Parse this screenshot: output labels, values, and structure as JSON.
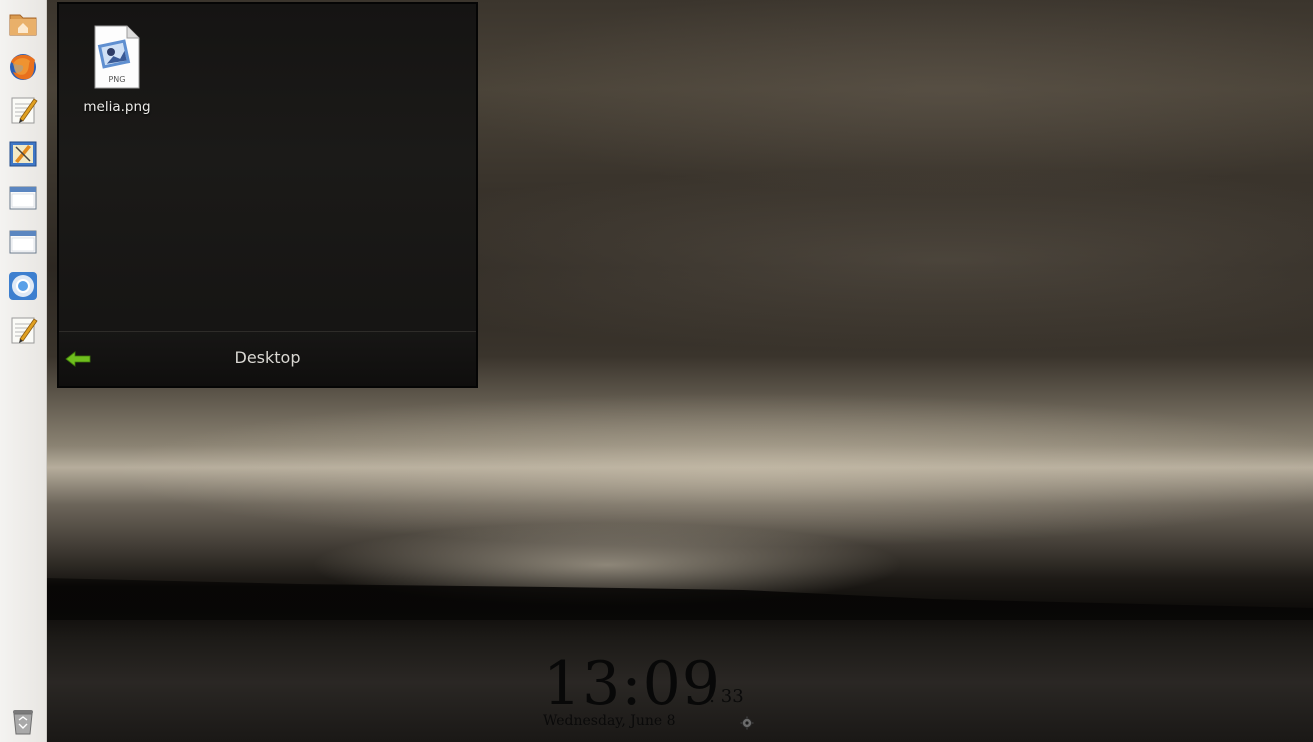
{
  "launcher": {
    "items": [
      {
        "name": "home-folder",
        "icon": "folder-home-icon"
      },
      {
        "name": "firefox",
        "icon": "firefox-icon"
      },
      {
        "name": "text-editor",
        "icon": "text-editor-icon"
      },
      {
        "name": "drawing-app",
        "icon": "drawing-app-icon"
      },
      {
        "name": "window-1",
        "icon": "window-icon"
      },
      {
        "name": "window-2",
        "icon": "window-icon"
      },
      {
        "name": "chromium",
        "icon": "chromium-icon"
      },
      {
        "name": "text-editor-2",
        "icon": "text-editor-icon"
      }
    ],
    "trash": {
      "icon": "trash-icon"
    }
  },
  "panel": {
    "title": "Desktop",
    "files": [
      {
        "label": "melia.png",
        "type": "PNG"
      }
    ]
  },
  "clock": {
    "time": "13:09",
    "seconds": ": 33",
    "date": "Wednesday, June 8"
  },
  "colors": {
    "launcher_bg": "#f4f3f1",
    "panel_bg": "#1b1a18",
    "back_arrow": "#6fbf1e"
  }
}
